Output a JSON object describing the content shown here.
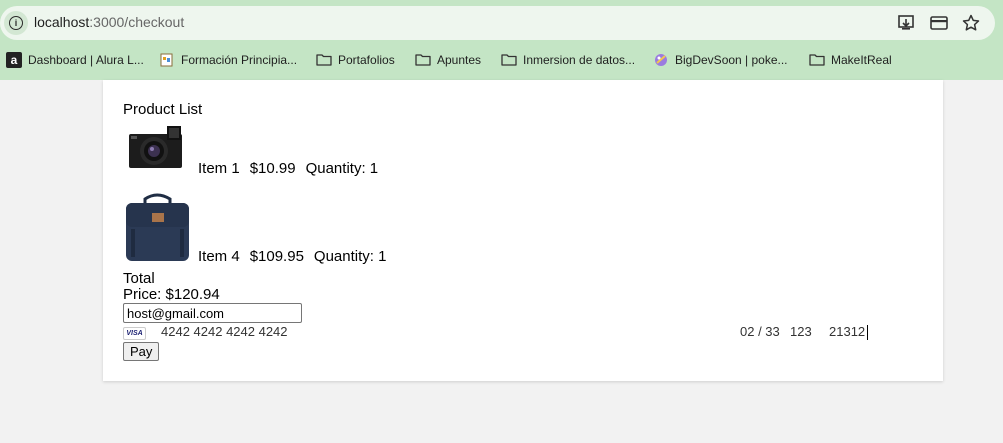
{
  "browser": {
    "url_host": "localhost",
    "url_path": ":3000/checkout",
    "bookmarks": [
      {
        "label": "Dashboard | Alura L...",
        "icon": "alura-icon"
      },
      {
        "label": "Formación Principia...",
        "icon": "page-icon"
      },
      {
        "label": "Portafolios",
        "icon": "folder-icon"
      },
      {
        "label": "Apuntes",
        "icon": "folder-icon"
      },
      {
        "label": "Inmersion de datos...",
        "icon": "folder-icon"
      },
      {
        "label": "BigDevSoon | poke...",
        "icon": "bigdevsoon-icon"
      },
      {
        "label": "MakeItReal",
        "icon": "folder-icon"
      }
    ]
  },
  "page": {
    "title": "Product List",
    "items": [
      {
        "name": "Item 1",
        "price": "$10.99",
        "quantity": "Quantity: 1",
        "image": "camera"
      },
      {
        "name": "Item 4",
        "price": "$109.95",
        "quantity": "Quantity: 1",
        "image": "backpack"
      }
    ],
    "total_label_line1": "Total",
    "total_label_line2": "Price: $120.94",
    "email_value": "host@gmail.com",
    "card": {
      "brand": "VISA",
      "number": "4242 4242 4242 4242",
      "expiry": "02 / 33",
      "cvc": "123",
      "zip": "21312"
    },
    "pay_label": "Pay"
  }
}
